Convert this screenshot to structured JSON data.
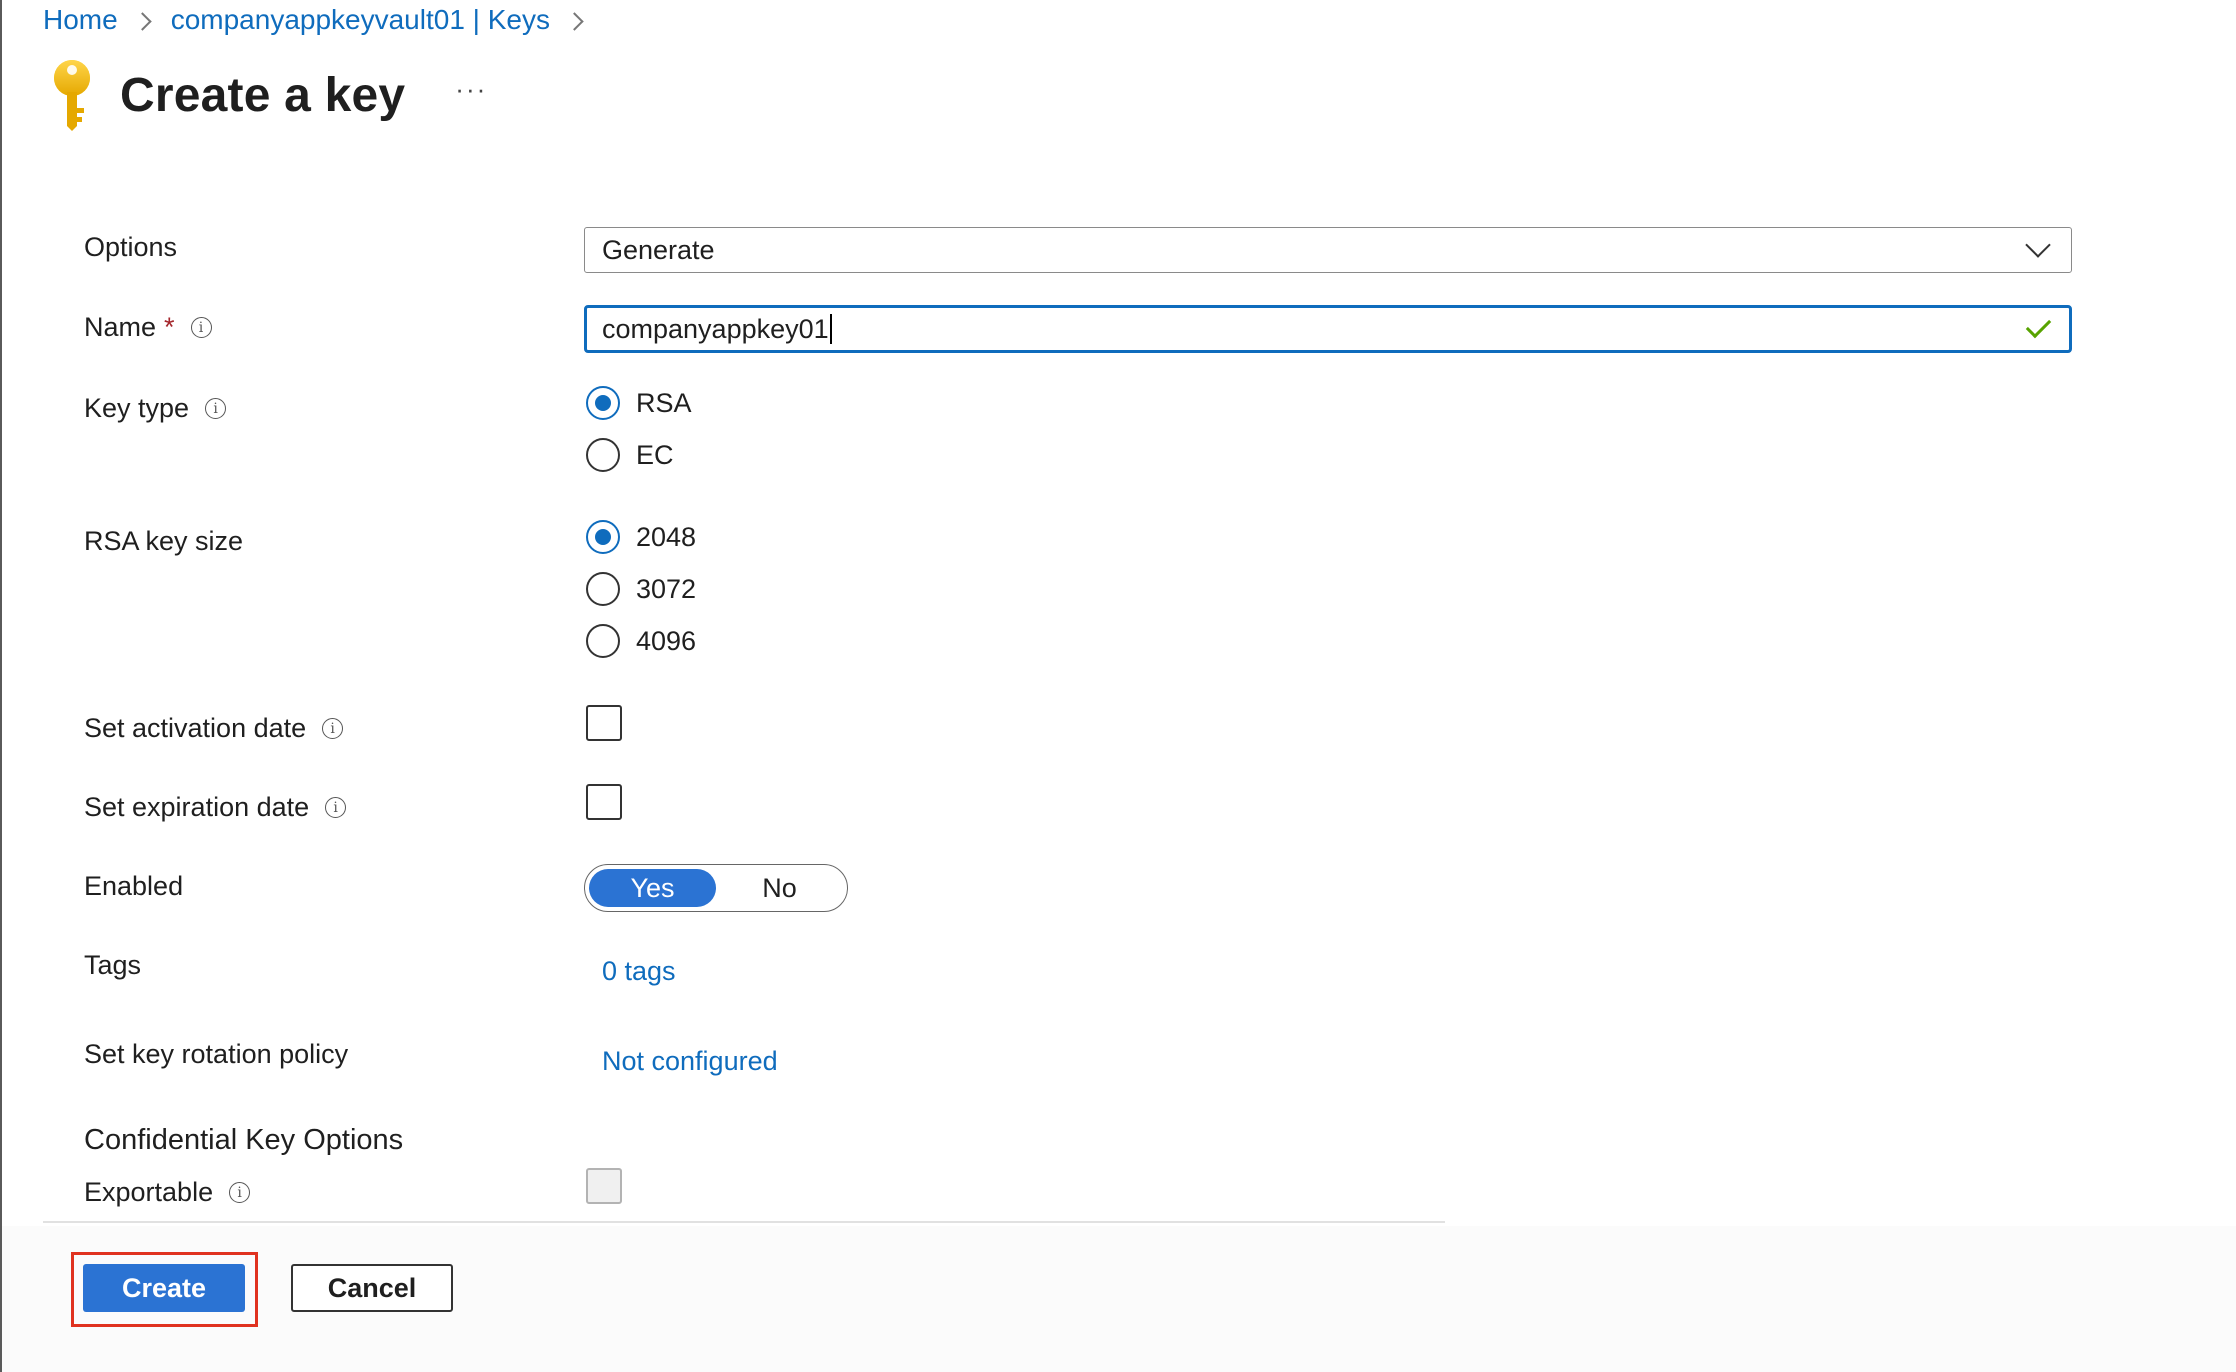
{
  "breadcrumb": {
    "home": "Home",
    "vault": "companyappkeyvault01 | Keys"
  },
  "header": {
    "title": "Create a key",
    "more": "···",
    "icon": "key-icon"
  },
  "form": {
    "options": {
      "label": "Options",
      "value": "Generate"
    },
    "name": {
      "label": "Name",
      "required_mark": "*",
      "value": "companyappkey01",
      "valid": true
    },
    "key_type": {
      "label": "Key type",
      "options": [
        "RSA",
        "EC"
      ],
      "selected": "RSA"
    },
    "rsa_key_size": {
      "label": "RSA key size",
      "options": [
        "2048",
        "3072",
        "4096"
      ],
      "selected": "2048"
    },
    "activation_date": {
      "label": "Set activation date",
      "checked": false
    },
    "expiration_date": {
      "label": "Set expiration date",
      "checked": false
    },
    "enabled": {
      "label": "Enabled",
      "yes": "Yes",
      "no": "No",
      "selected": "Yes"
    },
    "tags": {
      "label": "Tags",
      "value": "0 tags"
    },
    "rotation_policy": {
      "label": "Set key rotation policy",
      "value": "Not configured"
    },
    "confidential": {
      "heading": "Confidential Key Options",
      "exportable_label": "Exportable",
      "exportable_checked": false,
      "exportable_disabled": true
    }
  },
  "footer": {
    "create_label": "Create",
    "cancel_label": "Cancel"
  },
  "colors": {
    "accent": "#0f6cbd",
    "primary_button": "#2b73d3",
    "highlight_outline": "#e0321f",
    "valid_check": "#57a300",
    "required": "#a4262c"
  }
}
